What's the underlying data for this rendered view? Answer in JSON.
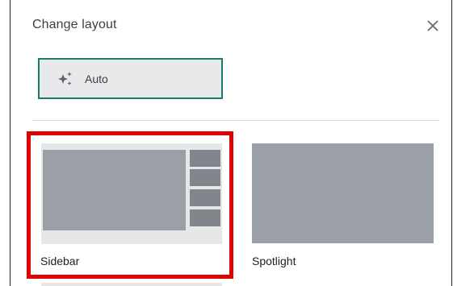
{
  "dialog": {
    "title": "Change layout",
    "close_icon": "close-icon"
  },
  "auto_option": {
    "label": "Auto",
    "icon": "sparkle-icon",
    "border_color": "#1f7a6e"
  },
  "layouts": [
    {
      "label": "Sidebar",
      "selected": true,
      "highlight_color": "#e00000"
    },
    {
      "label": "Spotlight",
      "selected": false
    }
  ]
}
